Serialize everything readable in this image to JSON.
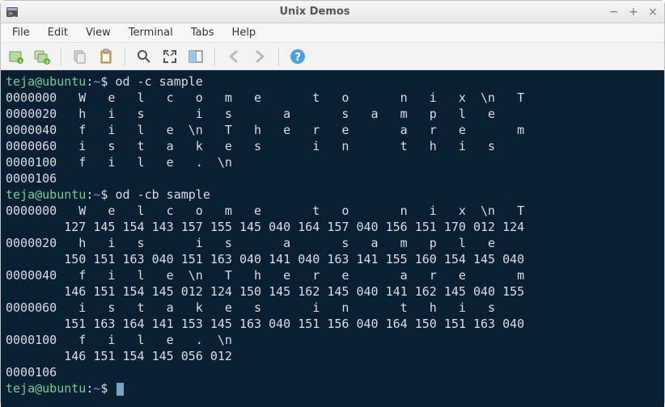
{
  "window": {
    "title": "Unix Demos",
    "buttons": {
      "min": "−",
      "max": "+",
      "close": "×"
    }
  },
  "menubar": [
    "File",
    "Edit",
    "View",
    "Terminal",
    "Tabs",
    "Help"
  ],
  "toolbar_icons": [
    "new-tab-icon",
    "new-window-icon",
    "sep",
    "copy-icon",
    "paste-icon",
    "sep",
    "search-icon",
    "fullscreen-icon",
    "split-icon",
    "sep",
    "back-icon",
    "forward-icon",
    "sep",
    "help-icon"
  ],
  "prompt": {
    "userhost": "teja@ubuntu",
    "sep": ":",
    "path": "~",
    "dollar": "$"
  },
  "commands": {
    "c1": "od -c sample",
    "c2": "od -cb sample"
  },
  "output1": [
    "0000000   W   e   l   c   o   m   e       t   o       n   i   x  \\n   T",
    "0000020   h   i   s       i   s       a       s   a   m   p   l   e    ",
    "0000040   f   i   l   e  \\n   T   h   e   r   e       a   r   e       m",
    "0000060   i   s   t   a   k   e   s       i   n       t   h   i   s    ",
    "0000100   f   i   l   e   .  \\n",
    "0000106"
  ],
  "output2": [
    "0000000   W   e   l   c   o   m   e       t   o       n   i   x  \\n   T",
    "        127 145 154 143 157 155 145 040 164 157 040 156 151 170 012 124",
    "0000020   h   i   s       i   s       a       s   a   m   p   l   e    ",
    "        150 151 163 040 151 163 040 141 040 163 141 155 160 154 145 040",
    "0000040   f   i   l   e  \\n   T   h   e   r   e       a   r   e       m",
    "        146 151 154 145 012 124 150 145 162 145 040 141 162 145 040 155",
    "0000060   i   s   t   a   k   e   s       i   n       t   h   i   s    ",
    "        151 163 164 141 153 145 163 040 151 156 040 164 150 151 163 040",
    "0000100   f   i   l   e   .  \\n",
    "        146 151 154 145 056 012",
    "0000106"
  ]
}
